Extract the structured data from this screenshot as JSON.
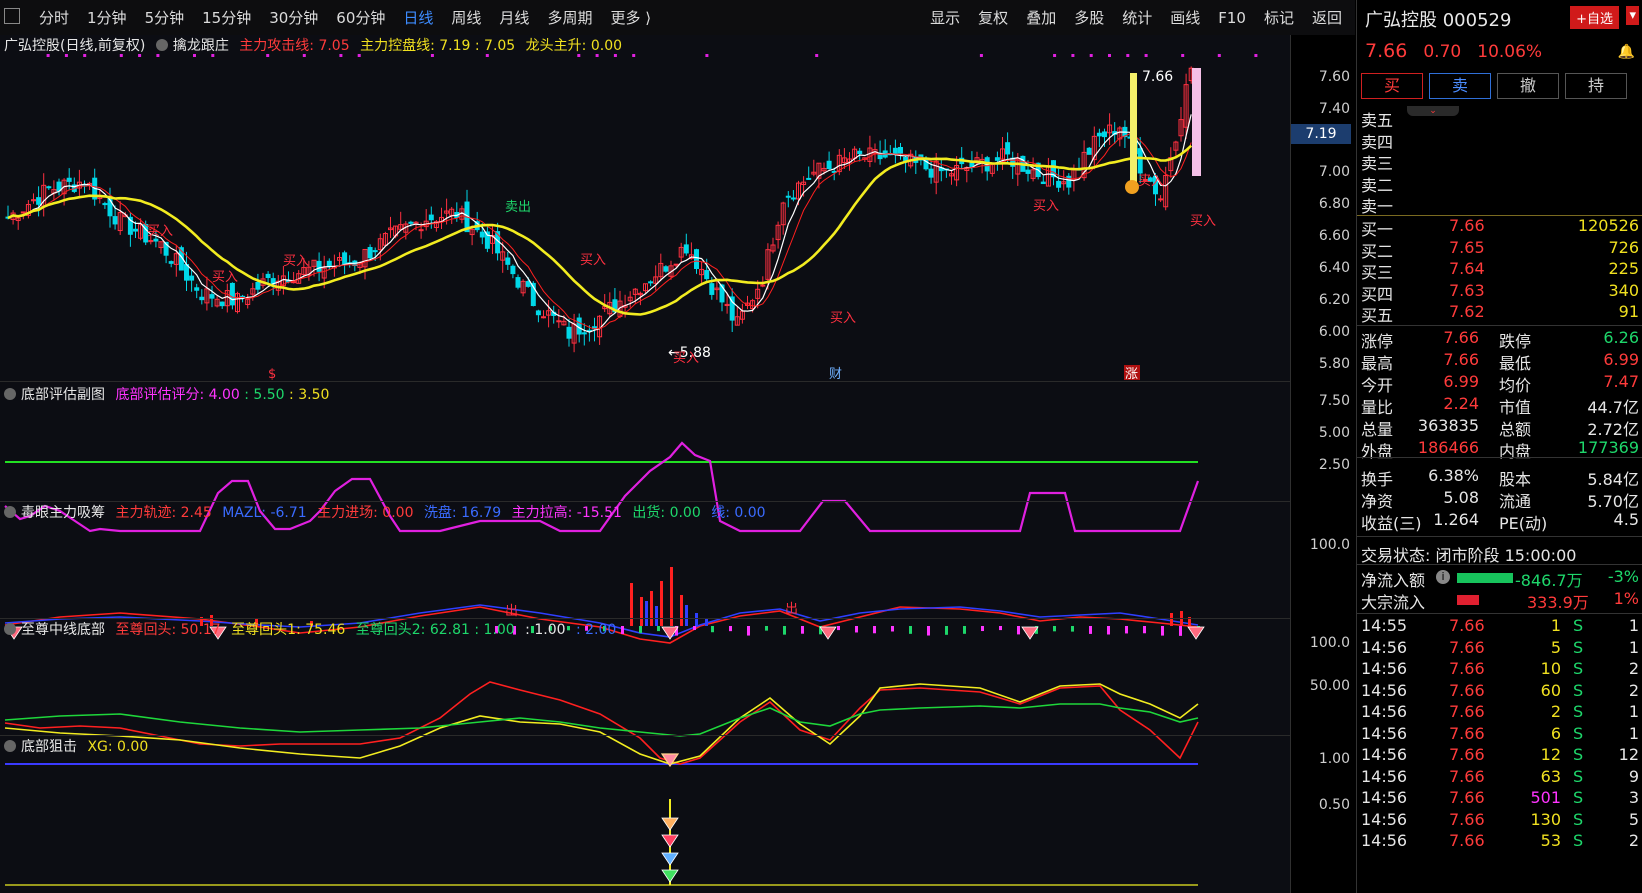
{
  "toolbar": {
    "periods": [
      "分时",
      "1分钟",
      "5分钟",
      "15分钟",
      "30分钟",
      "60分钟",
      "日线",
      "周线",
      "月线",
      "多周期",
      "更多 ⟩"
    ],
    "active_period": "日线",
    "tools": [
      "显示",
      "复权",
      "叠加",
      "多股",
      "统计",
      "画线",
      "F10",
      "标记",
      "返回"
    ]
  },
  "main_panel": {
    "stock_label": "广弘控股(日线,前复权)",
    "indicator": "擒龙跟庄",
    "attack_line": "主力攻击线: 7.05",
    "control_line": "主力控盘线: 7.19 : 7.05",
    "dragon_head": "龙头主升: 0.00",
    "y_ticks": [
      "7.60",
      "7.40",
      "7.20",
      "7.00",
      "6.80",
      "6.60",
      "6.40",
      "6.20",
      "6.00",
      "5.80"
    ],
    "price_tag": "7.19",
    "high_label": "7.66",
    "low_label": "←5.88",
    "signals": [
      "买入",
      "买入",
      "买入",
      "卖出",
      "买入",
      "买入",
      "买入",
      "买入",
      "买入",
      "买入"
    ],
    "markers": [
      "$",
      "财",
      "涨"
    ]
  },
  "panel2": {
    "title": "底部评估副图",
    "score": "底部评估评分: 4.00",
    "v2": ": 5.50",
    "v3": ": 3.50",
    "y_ticks": [
      "7.50",
      "5.00",
      "2.50"
    ]
  },
  "panel3": {
    "title": "毒眼主力吸筹",
    "track": "主力轨迹: 2.45",
    "mazl": "MAZL: -6.71",
    "enter": "主力进场: 0.00",
    "wash": "洗盘: 16.79",
    "raise": "主力拉高: -15.51",
    "ship": "出货: 0.00",
    "line": "线: 0.00",
    "y_ticks": [
      "100.0"
    ],
    "out_labels": [
      "出",
      "出"
    ]
  },
  "panel4": {
    "title": "至尊中线底部",
    "head": "至尊回头: 50.17",
    "head1": "至尊回头1: 75.46",
    "head2": "至尊回头2: 62.81",
    "v1": ": 1.00",
    "v2": ": 1.00",
    "v3": ": 2.00",
    "y_ticks": [
      "100.0",
      "50.00"
    ]
  },
  "panel5": {
    "title": "底部狙击",
    "xg": "XG: 0.00",
    "y_ticks": [
      "1.00",
      "0.50"
    ]
  },
  "quote": {
    "name": "广弘控股 000529",
    "fav": "+自选",
    "price": "7.66",
    "change": "0.70",
    "pct": "10.06%",
    "buttons": [
      "买",
      "卖",
      "撤",
      "持"
    ],
    "asks": [
      "卖五",
      "卖四",
      "卖三",
      "卖二",
      "卖一"
    ],
    "bids": [
      {
        "label": "买一",
        "price": "7.66",
        "vol": "120526"
      },
      {
        "label": "买二",
        "price": "7.65",
        "vol": "726"
      },
      {
        "label": "买三",
        "price": "7.64",
        "vol": "225"
      },
      {
        "label": "买四",
        "price": "7.63",
        "vol": "340"
      },
      {
        "label": "买五",
        "price": "7.62",
        "vol": "91"
      }
    ],
    "stats": [
      {
        "l1": "涨停",
        "v1": "7.66",
        "c1": "red",
        "l2": "跌停",
        "v2": "6.26",
        "c2": "green"
      },
      {
        "l1": "最高",
        "v1": "7.66",
        "c1": "red",
        "l2": "最低",
        "v2": "6.99",
        "c2": "red"
      },
      {
        "l1": "今开",
        "v1": "6.99",
        "c1": "red",
        "l2": "均价",
        "v2": "7.47",
        "c2": "red"
      },
      {
        "l1": "量比",
        "v1": "2.24",
        "c1": "red",
        "l2": "市值",
        "v2": "44.7亿",
        "c2": "white"
      },
      {
        "l1": "总量",
        "v1": "363835",
        "c1": "white",
        "l2": "总额",
        "v2": "2.72亿",
        "c2": "white"
      },
      {
        "l1": "外盘",
        "v1": "186466",
        "c1": "red",
        "l2": "内盘",
        "v2": "177369",
        "c2": "green"
      }
    ],
    "stats2": [
      {
        "l1": "换手",
        "v1": "6.38%",
        "l2": "股本",
        "v2": "5.84亿"
      },
      {
        "l1": "净资",
        "v1": "5.08",
        "l2": "流通",
        "v2": "5.70亿"
      },
      {
        "l1": "收益(三)",
        "v1": "1.264",
        "l2": "PE(动)",
        "v2": "4.5"
      }
    ],
    "status": "交易状态: 闭市阶段 15:00:00",
    "netflow_label": "净流入额",
    "netflow_val": "-846.7万",
    "netflow_pct": "-3%",
    "block_label": "大宗流入",
    "block_val": "333.9万",
    "block_pct": "1%",
    "ticks": [
      {
        "t": "14:55",
        "p": "7.66",
        "v": "1",
        "s": "S",
        "n": "1",
        "vc": "yellow"
      },
      {
        "t": "14:56",
        "p": "7.66",
        "v": "5",
        "s": "S",
        "n": "1",
        "vc": "yellow"
      },
      {
        "t": "14:56",
        "p": "7.66",
        "v": "10",
        "s": "S",
        "n": "2",
        "vc": "yellow"
      },
      {
        "t": "14:56",
        "p": "7.66",
        "v": "60",
        "s": "S",
        "n": "2",
        "vc": "yellow"
      },
      {
        "t": "14:56",
        "p": "7.66",
        "v": "2",
        "s": "S",
        "n": "1",
        "vc": "yellow"
      },
      {
        "t": "14:56",
        "p": "7.66",
        "v": "6",
        "s": "S",
        "n": "1",
        "vc": "yellow"
      },
      {
        "t": "14:56",
        "p": "7.66",
        "v": "12",
        "s": "S",
        "n": "12",
        "vc": "yellow"
      },
      {
        "t": "14:56",
        "p": "7.66",
        "v": "63",
        "s": "S",
        "n": "9",
        "vc": "yellow"
      },
      {
        "t": "14:56",
        "p": "7.66",
        "v": "501",
        "s": "S",
        "n": "3",
        "vc": "magenta"
      },
      {
        "t": "14:56",
        "p": "7.66",
        "v": "130",
        "s": "S",
        "n": "5",
        "vc": "yellow"
      },
      {
        "t": "14:56",
        "p": "7.66",
        "v": "53",
        "s": "S",
        "n": "2",
        "vc": "yellow"
      }
    ]
  }
}
